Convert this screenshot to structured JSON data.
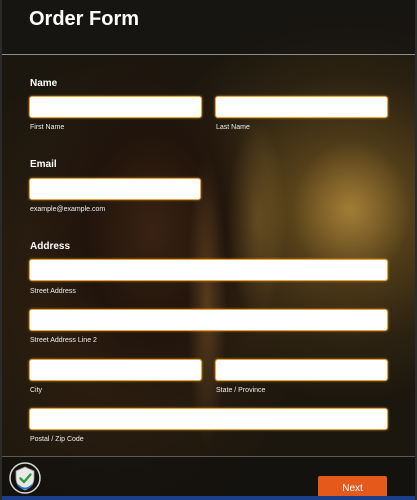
{
  "form": {
    "title": "Order Form"
  },
  "name_section": {
    "label": "Name",
    "first_name": {
      "value": "",
      "sublabel": "First Name"
    },
    "last_name": {
      "value": "",
      "sublabel": "Last Name"
    }
  },
  "email_section": {
    "label": "Email",
    "email": {
      "value": "",
      "sublabel": "example@example.com"
    }
  },
  "address_section": {
    "label": "Address",
    "street_address": {
      "value": "",
      "sublabel": "Street Address"
    },
    "street_address_2": {
      "value": "",
      "sublabel": "Street Address Line 2"
    },
    "city": {
      "value": "",
      "sublabel": "City"
    },
    "state": {
      "value": "",
      "sublabel": "State / Province"
    },
    "postal": {
      "value": "",
      "sublabel": "Postal / Zip Code"
    }
  },
  "footer": {
    "next_label": "Next"
  },
  "icons": {
    "badge": "shield-check-icon"
  },
  "colors": {
    "accent": "#e5591a",
    "field_border": "#e8a33c",
    "header_bg": "#141414"
  }
}
